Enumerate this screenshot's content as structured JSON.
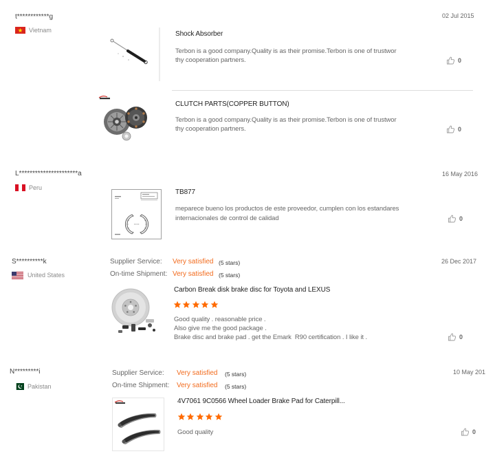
{
  "reviews": [
    {
      "username": "t************g",
      "country": "Vietnam",
      "flag_icon": "vietnam-flag-icon",
      "date": "02 Jul 2015",
      "products": [
        {
          "title": "Shock Absorber",
          "image_icon": "shock-absorber-image",
          "lines": [
            "Terbon is a good company.Quality is as their promise.Terbon is one of trustwor",
            "thy cooperation partners."
          ],
          "likes": "0"
        },
        {
          "title": "CLUTCH PARTS(COPPER BUTTON)",
          "image_icon": "clutch-parts-image",
          "lines": [
            "Terbon is a good company.Quality is as their promise.Terbon is one of trustwor",
            "thy cooperation partners."
          ],
          "likes": "0"
        }
      ]
    },
    {
      "username": "L**********************a",
      "country": "Peru",
      "flag_icon": "peru-flag-icon",
      "date": "16 May 2016",
      "products": [
        {
          "title": "TB877",
          "image_icon": "brake-shoe-drawing-image",
          "lines": [
            "meparece bueno los productos de este proveedor, cumplen con los estandares",
            "internacionales de control de calidad"
          ],
          "likes": "0"
        }
      ]
    },
    {
      "username": "S**********k",
      "country": "United States",
      "flag_icon": "united-states-flag-icon",
      "date": "26 Dec 2017",
      "ratings": [
        {
          "label": "Supplier Service:",
          "value": "Very satisfied",
          "stars_text": "(5 stars)"
        },
        {
          "label": "On-time Shipment:",
          "value": "Very satisfied",
          "stars_text": "(5 stars)"
        }
      ],
      "products": [
        {
          "title": "Carbon Break disk brake disc for Toyota and LEXUS",
          "image_icon": "brake-disc-image",
          "rating": 5,
          "lines": [
            "Good quality . reasonable price .",
            "Also give me the good package .",
            "Brake disc and brake pad . get the Emark  R90 certification . I like it ."
          ],
          "likes": "0"
        }
      ]
    },
    {
      "username": "N*********i",
      "country": "Pakistan",
      "flag_icon": "pakistan-flag-icon",
      "date": "10 May 201",
      "ratings": [
        {
          "label": "Supplier Service:",
          "value": "Very satisfied",
          "stars_text": "(5 stars)"
        },
        {
          "label": "On-time Shipment:",
          "value": "Very satisfied",
          "stars_text": "(5 stars)"
        }
      ],
      "products": [
        {
          "title": "4V7061 9C0566 Wheel Loader Brake Pad for Caterpill...",
          "image_icon": "brake-pad-image",
          "rating": 5,
          "lines": [
            "Good quality"
          ],
          "likes": "0"
        }
      ]
    }
  ],
  "icons": {
    "like": "thumbs-up-icon",
    "star": "star-icon"
  },
  "colors": {
    "rating_value": "#f26b1d",
    "star": "#ff6a00",
    "body_text": "#666666",
    "title_text": "#222222",
    "divider": "#dddddd"
  }
}
